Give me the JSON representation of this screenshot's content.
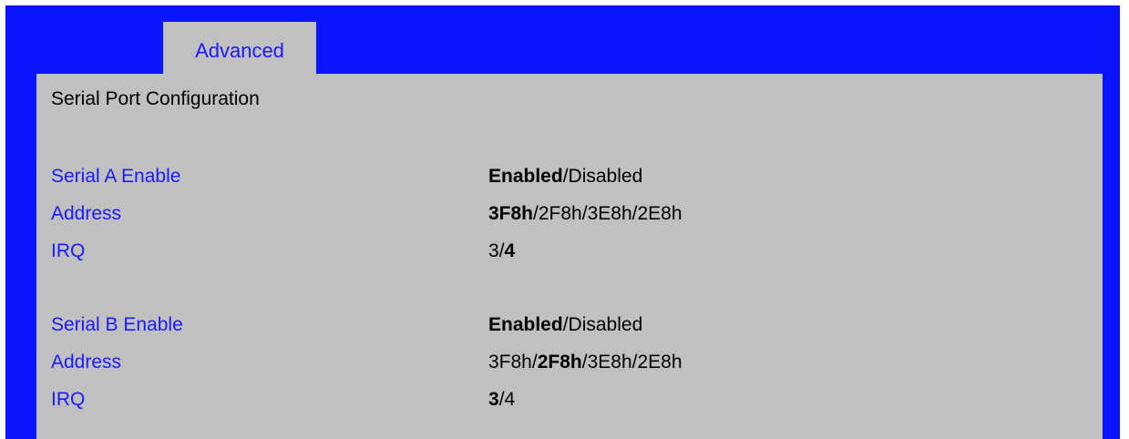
{
  "tabs": [
    {
      "label": "Advanced",
      "active": true
    }
  ],
  "section_title": "Serial Port Configuration",
  "settings": [
    {
      "label": "Serial A Enable",
      "options": [
        "Enabled",
        "Disabled"
      ],
      "selected": 0
    },
    {
      "label": "Address",
      "options": [
        "3F8h",
        "2F8h",
        "3E8h",
        "2E8h"
      ],
      "selected": 0
    },
    {
      "label": "IRQ",
      "options": [
        "3",
        "4"
      ],
      "selected": 1
    },
    {
      "label": "Serial B Enable",
      "options": [
        "Enabled",
        "Disabled"
      ],
      "selected": 0
    },
    {
      "label": "Address",
      "options": [
        "3F8h",
        "2F8h",
        "3E8h",
        "2E8h"
      ],
      "selected": 1
    },
    {
      "label": "IRQ",
      "options": [
        "3",
        "4"
      ],
      "selected": 0
    }
  ],
  "colors": {
    "frame": "#0a14ff",
    "panel": "#c0c0c0",
    "label_text": "#1a1aff",
    "value_text": "#000000"
  }
}
